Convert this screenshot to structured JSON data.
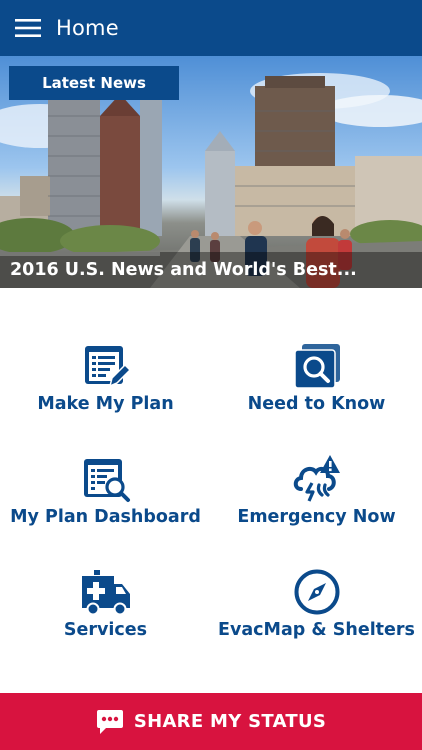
{
  "header": {
    "title": "Home",
    "menu_icon": "hamburger-menu-icon"
  },
  "news": {
    "tag_label": "Latest News",
    "headline": "2016 U.S. News and World's Best..."
  },
  "tiles": [
    {
      "label": "Make My Plan",
      "icon": "plan-document-edit-icon"
    },
    {
      "label": "Need to Know",
      "icon": "search-document-icon"
    },
    {
      "label": "My Plan Dashboard",
      "icon": "dashboard-search-icon"
    },
    {
      "label": "Emergency Now",
      "icon": "storm-alert-icon"
    },
    {
      "label": "Services",
      "icon": "ambulance-icon"
    },
    {
      "label": "EvacMap & Shelters",
      "icon": "compass-icon"
    }
  ],
  "share": {
    "label": "SHARE MY STATUS",
    "icon": "chat-bubble-icon"
  },
  "colors": {
    "brand_blue": "#0b4a8b",
    "share_red": "#d8133f"
  }
}
